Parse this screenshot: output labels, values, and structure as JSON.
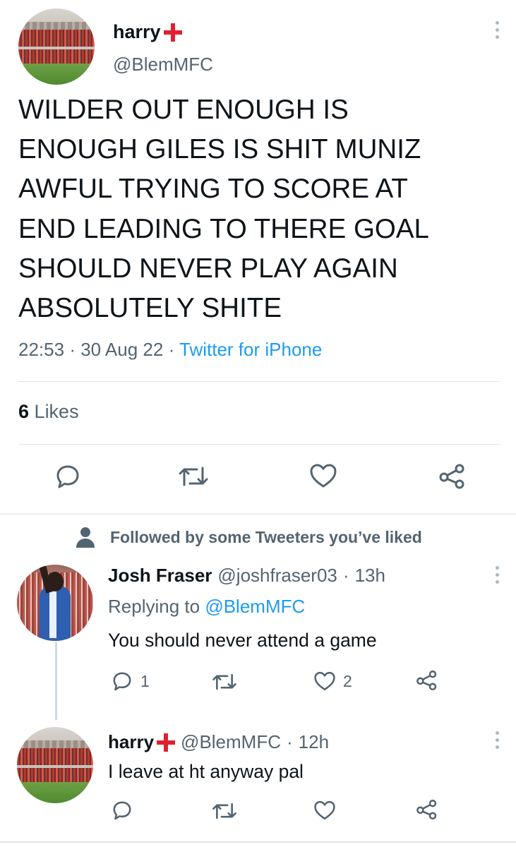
{
  "main_tweet": {
    "author_name": "harry",
    "author_handle": "@BlemMFC",
    "text_lines": [
      "WILDER OUT ENOUGH IS",
      "ENOUGH GILES IS SHIT MUNIZ",
      "AWFUL TRYING TO SCORE AT",
      "END LEADING TO THERE GOAL",
      "SHOULD NEVER PLAY AGAIN",
      "ABSOLUTELY SHITE"
    ],
    "time": "22:53",
    "date": "30 Aug 22",
    "source": "Twitter for iPhone",
    "likes_count": "6",
    "likes_label": "Likes"
  },
  "followed_notice": "Followed by some Tweeters you’ve liked",
  "replies": [
    {
      "author_name": "Josh Fraser",
      "author_handle": "@joshfraser03",
      "age": "13h",
      "replying_prefix": "Replying to",
      "replying_to": "@BlemMFC",
      "text": "You should never attend a game",
      "reply_count": "1",
      "like_count": "2"
    },
    {
      "author_name": "harry",
      "author_handle": "@BlemMFC",
      "age": "12h",
      "text": "I leave at ht anyway pal",
      "reply_count": "",
      "like_count": ""
    }
  ],
  "separator": "·",
  "colors": {
    "text": "#0f1419",
    "secondary": "#536471",
    "link": "#1d9bf0",
    "flag_red": "#e0202f",
    "divider": "#e1e6ea"
  },
  "icons": [
    "reply-icon",
    "retweet-icon",
    "like-icon",
    "share-icon",
    "more-icon",
    "person-icon",
    "england-flag-icon"
  ]
}
